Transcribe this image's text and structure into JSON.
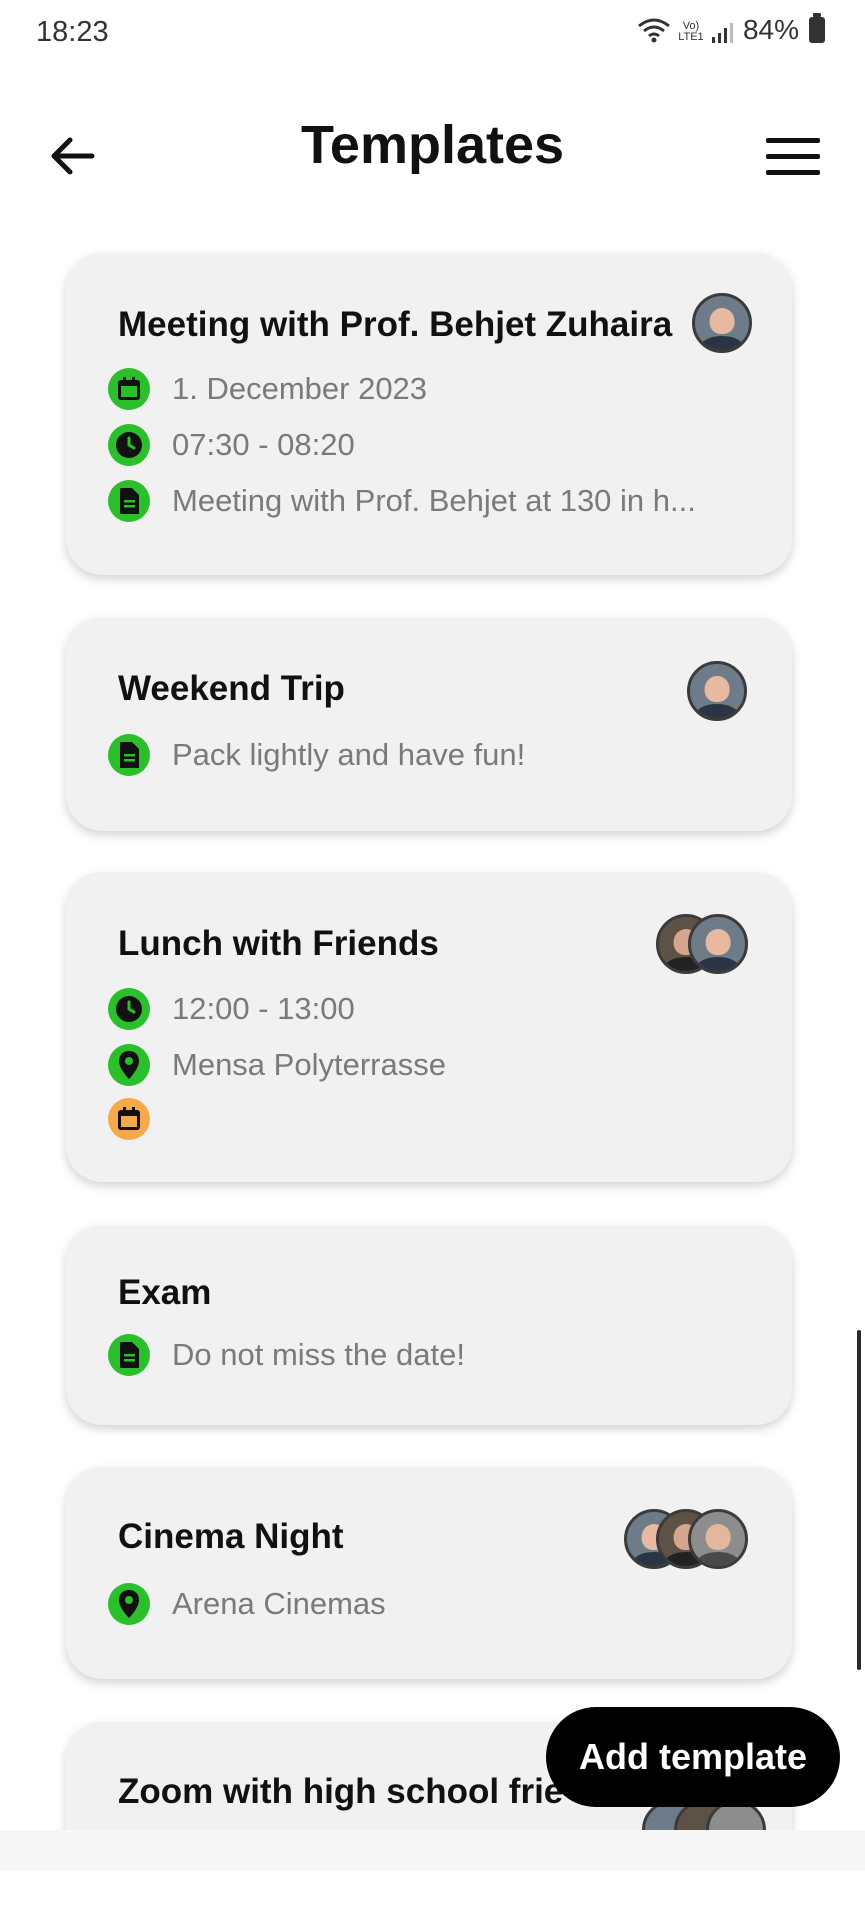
{
  "status": {
    "time": "18:23",
    "network_label": "Vo) LTE1",
    "battery": "84%"
  },
  "header": {
    "title": "Templates",
    "back_icon": "arrow-left-icon",
    "menu_icon": "hamburger-menu-icon"
  },
  "colors": {
    "card_bg": "#f1f1f1",
    "icon_green": "#2bbf2b",
    "icon_orange": "#f6a94a",
    "fab_bg": "#000000"
  },
  "templates": [
    {
      "title": "Meeting with Prof. Behjet Zuhaira",
      "date": "1. December 2023",
      "time": "07:30 - 08:20",
      "note": "Meeting with Prof. Behjet at 130 in h..."
    },
    {
      "title": "Weekend Trip",
      "note": "Pack lightly and have fun!"
    },
    {
      "title": "Lunch with Friends",
      "time": "12:00 - 13:00",
      "location": "Mensa Polyterrasse"
    },
    {
      "title": "Exam",
      "note": "Do not miss the date!"
    },
    {
      "title": "Cinema Night",
      "location": "Arena Cinemas"
    },
    {
      "title": "Zoom with high school frie"
    }
  ],
  "actions": {
    "add_template": "Add template"
  }
}
